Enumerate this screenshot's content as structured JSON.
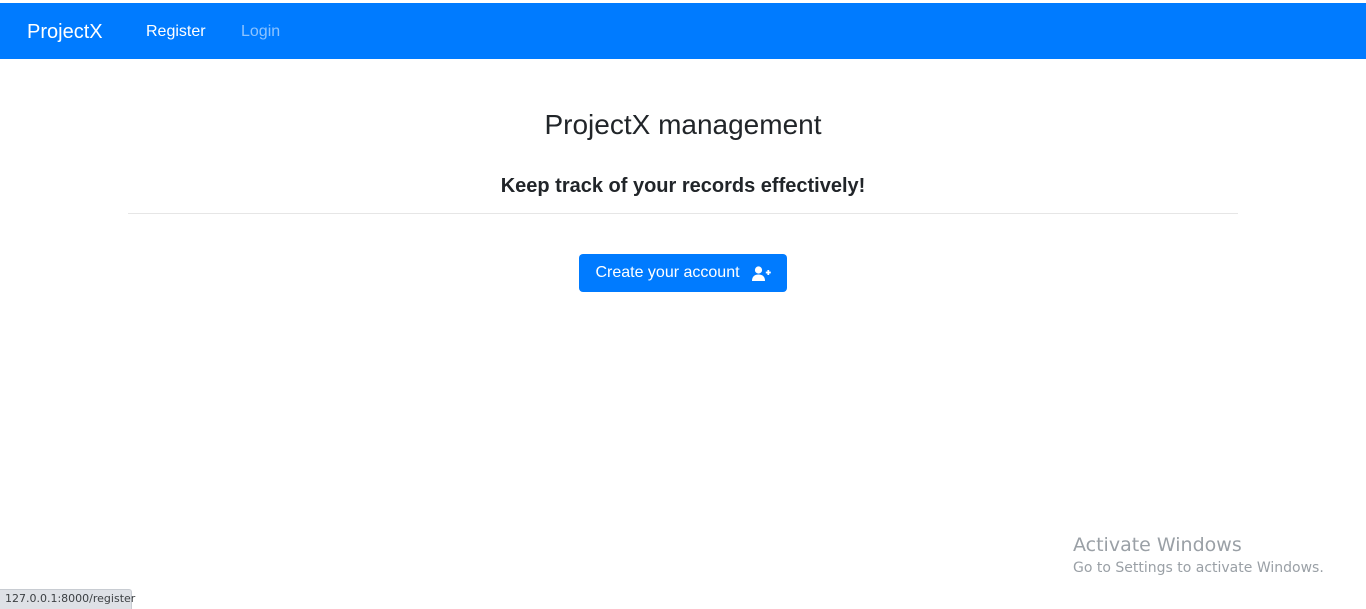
{
  "navbar": {
    "brand": "ProjectX",
    "links": [
      {
        "label": "Register",
        "active": true
      },
      {
        "label": "Login",
        "active": false
      }
    ],
    "background_color": "#007bff"
  },
  "hero": {
    "title": "ProjectX management",
    "subtitle": "Keep track of your records effectively!",
    "cta_label": "Create your account",
    "cta_icon": "user-plus-icon"
  },
  "watermark": {
    "title": "Activate Windows",
    "subtitle": "Go to Settings to activate Windows."
  },
  "status_bar": {
    "url": "127.0.0.1:8000/register"
  }
}
